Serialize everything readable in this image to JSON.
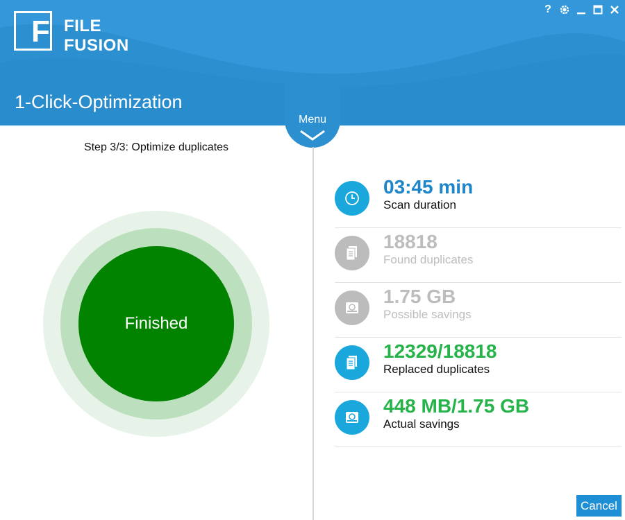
{
  "app": {
    "logo_letter": "F",
    "logo_line1": "FILE",
    "logo_line2": "FUSION",
    "title": "1-Click-Optimization"
  },
  "window_controls": {
    "help": "?",
    "settings": "⚙",
    "minimize": "—",
    "maximize": "☐",
    "close": "✕"
  },
  "menu": {
    "label": "Menu"
  },
  "step": {
    "label": "Step 3/3: Optimize duplicates"
  },
  "status_circle": {
    "label": "Finished"
  },
  "stats": [
    {
      "value": "03:45 min",
      "label": "Scan duration",
      "icon": "clock-icon"
    },
    {
      "value": "18818",
      "label": "Found duplicates",
      "icon": "document-icon"
    },
    {
      "value": "1.75 GB",
      "label": "Possible savings",
      "icon": "hard-drive-icon"
    },
    {
      "value": "12329/18818",
      "label": "Replaced duplicates",
      "icon": "document-icon"
    },
    {
      "value": "448 MB/1.75 GB",
      "label": "Actual savings",
      "icon": "hard-drive-icon"
    }
  ],
  "footer": {
    "cancel_label": "Cancel"
  },
  "colors": {
    "header": "#2b8fd0",
    "finished_green": "#028300",
    "value_green": "#26b349",
    "value_blue": "#1e86c8",
    "inactive_gray": "#bdbdbd"
  }
}
